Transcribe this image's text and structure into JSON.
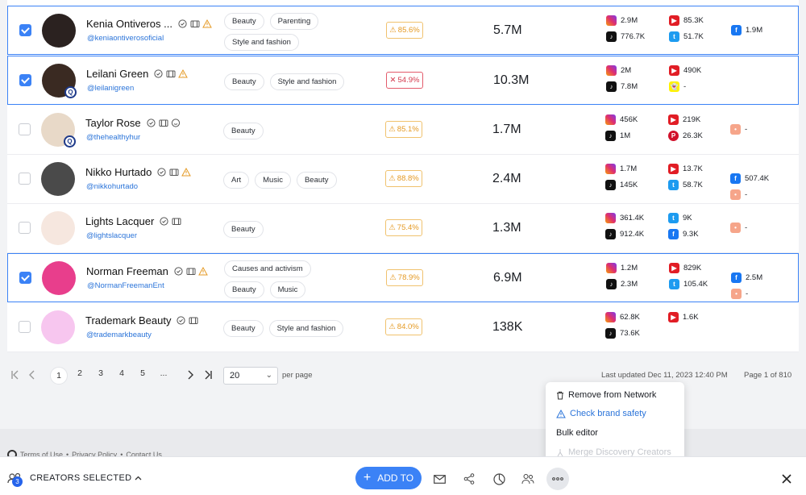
{
  "rows": [
    {
      "name": "Kenia Ontiveros ...",
      "handle": "@keniaontiverosoficial",
      "checked": true,
      "tags": [
        "Beauty",
        "Parenting",
        "Style and fashion"
      ],
      "score": "85.6%",
      "score_status": "warning",
      "reach": "5.7M",
      "socials": [
        [
          "ig",
          "2.9M"
        ],
        [
          "tt",
          "776.7K"
        ],
        [
          "yt",
          "85.3K"
        ],
        [
          "tw",
          "51.7K"
        ],
        [
          "fb",
          "1.9M"
        ],
        null
      ],
      "icons": [
        "check",
        "id",
        "warn"
      ],
      "avatar_color": "#2b2220",
      "verified_badge": false
    },
    {
      "name": "Leilani Green",
      "handle": "@leilanigreen",
      "checked": true,
      "tags": [
        "Beauty",
        "Style and fashion"
      ],
      "score": "54.9%",
      "score_status": "bad",
      "reach": "10.3M",
      "socials": [
        [
          "ig",
          "2M"
        ],
        [
          "tt",
          "7.8M"
        ],
        [
          "yt",
          "490K"
        ],
        [
          "sc",
          "-"
        ],
        null,
        null
      ],
      "icons": [
        "check",
        "id",
        "warn"
      ],
      "avatar_color": "#3a2a22",
      "verified_badge": true
    },
    {
      "name": "Taylor Rose",
      "handle": "@thehealthyhur",
      "checked": false,
      "tags": [
        "Beauty"
      ],
      "score": "85.1%",
      "score_status": "warning",
      "reach": "1.7M",
      "socials": [
        [
          "ig",
          "456K"
        ],
        [
          "tt",
          "1M"
        ],
        [
          "yt",
          "219K"
        ],
        [
          "pin",
          "26.3K"
        ],
        [
          "rss",
          "-"
        ],
        null
      ],
      "icons": [
        "check",
        "id",
        "smile"
      ],
      "avatar_color": "#e8d9c8",
      "verified_badge": true
    },
    {
      "name": "Nikko Hurtado",
      "handle": "@nikkohurtado",
      "checked": false,
      "tags": [
        "Art",
        "Music",
        "Beauty"
      ],
      "score": "88.8%",
      "score_status": "warning",
      "reach": "2.4M",
      "socials": [
        [
          "ig",
          "1.7M"
        ],
        [
          "tt",
          "145K"
        ],
        [
          "yt",
          "13.7K"
        ],
        [
          "tw",
          "58.7K"
        ],
        [
          "fb",
          "507.4K"
        ],
        [
          "rss",
          "-"
        ]
      ],
      "icons": [
        "check",
        "id",
        "warn"
      ],
      "avatar_color": "#4a4a4a",
      "verified_badge": false
    },
    {
      "name": "Lights Lacquer",
      "handle": "@lightslacquer",
      "checked": false,
      "tags": [
        "Beauty"
      ],
      "score": "75.4%",
      "score_status": "warning",
      "reach": "1.3M",
      "socials": [
        [
          "ig",
          "361.4K"
        ],
        [
          "tt",
          "912.4K"
        ],
        [
          "tw",
          "9K"
        ],
        [
          "fb",
          "9.3K"
        ],
        [
          "rss",
          "-"
        ],
        null
      ],
      "icons": [
        "check",
        "id"
      ],
      "avatar_color": "#f6e7df",
      "verified_badge": false
    },
    {
      "name": "Norman Freeman",
      "handle": "@NormanFreemanEnt",
      "checked": true,
      "tags": [
        "Causes and activism",
        "Beauty",
        "Music"
      ],
      "score": "78.9%",
      "score_status": "warning",
      "reach": "6.9M",
      "socials": [
        [
          "ig",
          "1.2M"
        ],
        [
          "tt",
          "2.3M"
        ],
        [
          "yt",
          "829K"
        ],
        [
          "tw",
          "105.4K"
        ],
        [
          "fb",
          "2.5M"
        ],
        [
          "rss",
          "-"
        ]
      ],
      "icons": [
        "check",
        "id",
        "warn"
      ],
      "avatar_color": "#e83e8c",
      "verified_badge": false
    },
    {
      "name": "Trademark Beauty",
      "handle": "@trademarkbeauty",
      "checked": false,
      "tags": [
        "Beauty",
        "Style and fashion"
      ],
      "score": "84.0%",
      "score_status": "warning",
      "reach": "138K",
      "socials": [
        [
          "ig",
          "62.8K"
        ],
        [
          "tt",
          "73.6K"
        ],
        [
          "yt",
          "1.6K"
        ],
        null,
        null,
        null
      ],
      "icons": [
        "check",
        "id"
      ],
      "avatar_color": "#f7c6ef",
      "verified_badge": false
    }
  ],
  "pagination": {
    "pages": [
      "1",
      "2",
      "3",
      "4",
      "5",
      "..."
    ],
    "current": "1",
    "per_page": "20",
    "per_page_label": "per page",
    "last_updated": "Last updated Dec 11, 2023 12:40 PM",
    "page_of": "Page 1 of 810"
  },
  "footer": {
    "links": [
      "Terms of Use",
      "Privacy Policy",
      "Contact Us"
    ]
  },
  "popup_menu": {
    "remove": "Remove from Network",
    "brand_safety": "Check brand safety",
    "bulk_editor": "Bulk editor",
    "merge": "Merge Discovery Creators"
  },
  "bottom_bar": {
    "selected_count": "3",
    "selected_label": "CREATORS SELECTED",
    "add_to": "ADD TO"
  },
  "colors": {
    "accent": "#3b82f6",
    "warning": "#e59a24",
    "danger": "#d4394d"
  }
}
